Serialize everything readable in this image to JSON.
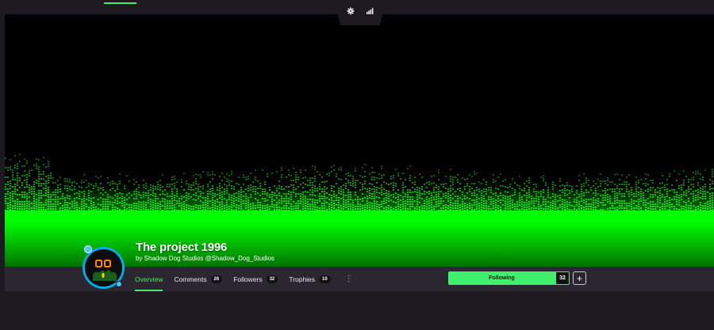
{
  "colors": {
    "accent": "#3ef06a",
    "banner_green": "#00ff00",
    "avatar_ring": "#00aeea",
    "page_bg": "#1c1a20",
    "nav_bg": "#2a2730"
  },
  "toolbar": {
    "icons": [
      "gear-icon",
      "bar-chart-icon"
    ]
  },
  "project": {
    "title": "The project 1996",
    "byline": "by Shadow Dog Studios @Shadow_Dog_Studios"
  },
  "tabs": [
    {
      "label": "Overview",
      "count": null,
      "active": true
    },
    {
      "label": "Comments",
      "count": "26",
      "active": false
    },
    {
      "label": "Followers",
      "count": "32",
      "active": false
    },
    {
      "label": "Trophies",
      "count": "10",
      "active": false
    }
  ],
  "more_icon": "⋮",
  "follow": {
    "label": "Following",
    "count": "32",
    "plus": "+"
  }
}
